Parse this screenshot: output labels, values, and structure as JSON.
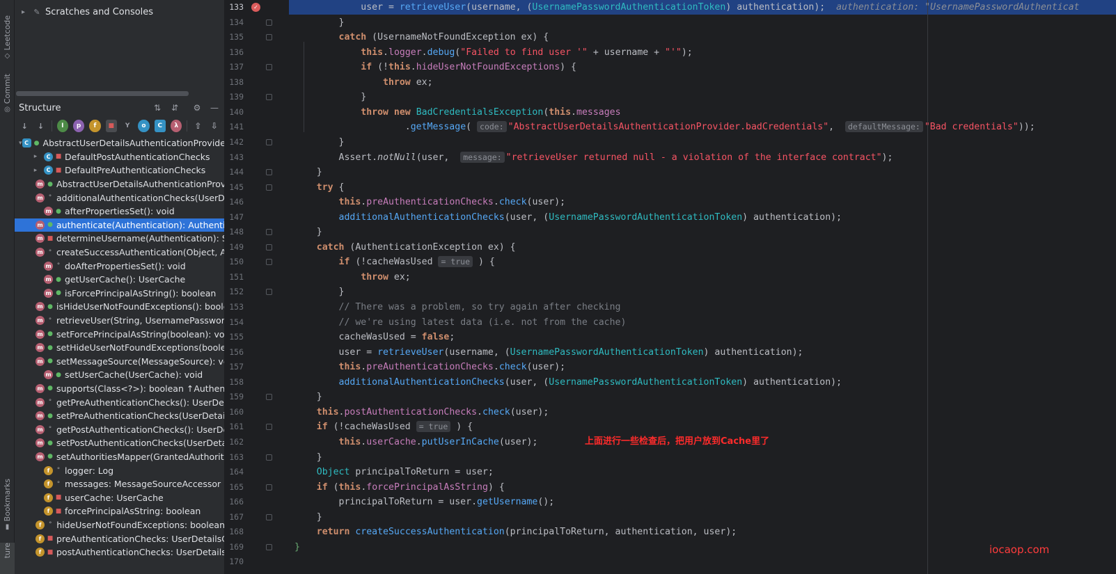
{
  "tool_strip": {
    "leetcode_label": "Leetcode",
    "commit_label": "Commit",
    "bookmarks_label": "Bookmarks",
    "structure_label": "ture"
  },
  "project": {
    "rows": [
      {
        "label": "Scratches and Consoles",
        "icon": "scratches-icon"
      }
    ]
  },
  "structure": {
    "title": "Structure",
    "tree": [
      {
        "label": "AbstractUserDetailsAuthenticationProvider",
        "kind": "class",
        "indent": 0,
        "expanded": true,
        "vis": "pub"
      },
      {
        "label": "DefaultPostAuthenticationChecks",
        "kind": "c",
        "indent": 1,
        "expandable": true,
        "vis": "lock"
      },
      {
        "label": "DefaultPreAuthenticationChecks",
        "kind": "c",
        "indent": 1,
        "expandable": true,
        "vis": "lock"
      },
      {
        "label": "AbstractUserDetailsAuthenticationProvic",
        "kind": "m",
        "indent": 1,
        "vis": "pub"
      },
      {
        "label": "additionalAuthenticationChecks(UserDet",
        "kind": "m",
        "indent": 1,
        "vis": "pkg"
      },
      {
        "label": "afterPropertiesSet(): void",
        "kind": "m",
        "indent": 1,
        "vis": "pub"
      },
      {
        "label": "authenticate(Authentication): Authenticat",
        "kind": "m",
        "indent": 1,
        "vis": "pub",
        "selected": true
      },
      {
        "label": "determineUsername(Authentication): Str",
        "kind": "m",
        "indent": 1,
        "vis": "lock"
      },
      {
        "label": "createSuccessAuthentication(Object, Aut",
        "kind": "m",
        "indent": 1,
        "vis": "pkg"
      },
      {
        "label": "doAfterPropertiesSet(): void",
        "kind": "m",
        "indent": 1,
        "vis": "pkg"
      },
      {
        "label": "getUserCache(): UserCache",
        "kind": "m",
        "indent": 1,
        "vis": "pub"
      },
      {
        "label": "isForcePrincipalAsString(): boolean",
        "kind": "m",
        "indent": 1,
        "vis": "pub"
      },
      {
        "label": "isHideUserNotFoundExceptions(): boole",
        "kind": "m",
        "indent": 1,
        "vis": "pub"
      },
      {
        "label": "retrieveUser(String, UsernamePassword",
        "kind": "m",
        "indent": 1,
        "vis": "pkg"
      },
      {
        "label": "setForcePrincipalAsString(boolean): voic",
        "kind": "m",
        "indent": 1,
        "vis": "pub"
      },
      {
        "label": "setHideUserNotFoundExceptions(boole",
        "kind": "m",
        "indent": 1,
        "vis": "pub"
      },
      {
        "label": "setMessageSource(MessageSource): vc",
        "kind": "m",
        "indent": 1,
        "vis": "pub"
      },
      {
        "label": "setUserCache(UserCache): void",
        "kind": "m",
        "indent": 1,
        "vis": "pub"
      },
      {
        "label": "supports(Class<?>): boolean ↑Authentic",
        "kind": "m",
        "indent": 1,
        "vis": "pub"
      },
      {
        "label": "getPreAuthenticationChecks(): UserDeta",
        "kind": "m",
        "indent": 1,
        "vis": "pkg"
      },
      {
        "label": "setPreAuthenticationChecks(UserDetails",
        "kind": "m",
        "indent": 1,
        "vis": "pub"
      },
      {
        "label": "getPostAuthenticationChecks(): UserDet",
        "kind": "m",
        "indent": 1,
        "vis": "pkg"
      },
      {
        "label": "setPostAuthenticationChecks(UserDetail",
        "kind": "m",
        "indent": 1,
        "vis": "pub"
      },
      {
        "label": "setAuthoritiesMapper(GrantedAuthoritie",
        "kind": "m",
        "indent": 1,
        "vis": "pub"
      },
      {
        "label": "logger: Log",
        "kind": "f",
        "indent": 1,
        "vis": "pkg"
      },
      {
        "label": "messages: MessageSourceAccessor",
        "kind": "f",
        "indent": 1,
        "vis": "pkg"
      },
      {
        "label": "userCache: UserCache",
        "kind": "f",
        "indent": 1,
        "vis": "lock"
      },
      {
        "label": "forcePrincipalAsString: boolean",
        "kind": "f",
        "indent": 1,
        "vis": "lock"
      },
      {
        "label": "hideUserNotFoundExceptions: boolean",
        "kind": "f",
        "indent": 1,
        "vis": "pkg"
      },
      {
        "label": "preAuthenticationChecks: UserDetailsCh",
        "kind": "f",
        "indent": 1,
        "vis": "lock"
      },
      {
        "label": "postAuthenticationChecks: UserDetailsC",
        "kind": "f",
        "indent": 1,
        "vis": "lock"
      }
    ]
  },
  "editor": {
    "annotation": "上面进行一些检查后，把用户放到Cache里了",
    "watermark": "iocaop.com",
    "line_numbers": [
      "133",
      "134",
      "135",
      "136",
      "137",
      "138",
      "139",
      "140",
      "141",
      "142",
      "143",
      "144",
      "145",
      "146",
      "147",
      "148",
      "149",
      "150",
      "151",
      "152",
      "153",
      "154",
      "155",
      "156",
      "157",
      "158",
      "159",
      "160",
      "161",
      "162",
      "163",
      "164",
      "165",
      "166",
      "167",
      "168",
      "169",
      "170"
    ],
    "current_line": "133",
    "lines": [
      [
        {
          "t": "            user = "
        },
        {
          "t": "retrieveUser",
          "c": "fn"
        },
        {
          "t": "(username, ("
        },
        {
          "t": "UsernamePasswordAuthenticationToken",
          "c": "typ"
        },
        {
          "t": ") authentication);  "
        },
        {
          "t": "authentication: \"UsernamePasswordAuthenticat",
          "c": "inl"
        }
      ],
      [
        {
          "t": "        }"
        }
      ],
      [
        {
          "t": "        "
        },
        {
          "t": "catch",
          "c": "kw"
        },
        {
          "t": " (UsernameNotFoundException ex) {"
        }
      ],
      [
        {
          "t": "            "
        },
        {
          "t": "this",
          "c": "kw"
        },
        {
          "t": "."
        },
        {
          "t": "logger",
          "c": "fld"
        },
        {
          "t": "."
        },
        {
          "t": "debug",
          "c": "fn"
        },
        {
          "t": "("
        },
        {
          "t": "\"Failed to find user '\"",
          "c": "istr"
        },
        {
          "t": " + username + "
        },
        {
          "t": "\"'\"",
          "c": "istr"
        },
        {
          "t": ");"
        }
      ],
      [
        {
          "t": "            "
        },
        {
          "t": "if",
          "c": "kw"
        },
        {
          "t": " (!"
        },
        {
          "t": "this",
          "c": "kw"
        },
        {
          "t": "."
        },
        {
          "t": "hideUserNotFoundExceptions",
          "c": "fld"
        },
        {
          "t": ") {"
        }
      ],
      [
        {
          "t": "                "
        },
        {
          "t": "throw",
          "c": "kw"
        },
        {
          "t": " ex;"
        }
      ],
      [
        {
          "t": "            }"
        }
      ],
      [
        {
          "t": "            "
        },
        {
          "t": "throw new",
          "c": "kw"
        },
        {
          "t": " "
        },
        {
          "t": "BadCredentialsException",
          "c": "typ"
        },
        {
          "t": "("
        },
        {
          "t": "this",
          "c": "kw"
        },
        {
          "t": "."
        },
        {
          "t": "messages",
          "c": "fld"
        }
      ],
      [
        {
          "t": "                    ."
        },
        {
          "t": "getMessage",
          "c": "fn"
        },
        {
          "t": "( "
        },
        {
          "t": "code:",
          "c": "hint"
        },
        {
          "t": "\"AbstractUserDetailsAuthenticationProvider.badCredentials\"",
          "c": "istr"
        },
        {
          "t": ",  "
        },
        {
          "t": "defaultMessage:",
          "c": "hint"
        },
        {
          "t": "\"Bad credentials\"",
          "c": "istr"
        },
        {
          "t": "));"
        }
      ],
      [
        {
          "t": "        }"
        }
      ],
      [
        {
          "t": "        "
        },
        {
          "t": "Assert",
          "c": "cls2"
        },
        {
          "t": "."
        },
        {
          "t": "notNull",
          "c": "ital"
        },
        {
          "t": "(user,  "
        },
        {
          "t": "message:",
          "c": "hint"
        },
        {
          "t": "\"retrieveUser returned null - a violation of the interface contract\"",
          "c": "istr"
        },
        {
          "t": ");"
        }
      ],
      [
        {
          "t": "    }"
        }
      ],
      [
        {
          "t": "    "
        },
        {
          "t": "try",
          "c": "kw"
        },
        {
          "t": " {"
        }
      ],
      [
        {
          "t": "        "
        },
        {
          "t": "this",
          "c": "kw"
        },
        {
          "t": "."
        },
        {
          "t": "preAuthenticationChecks",
          "c": "fld"
        },
        {
          "t": "."
        },
        {
          "t": "check",
          "c": "fn"
        },
        {
          "t": "(user);"
        }
      ],
      [
        {
          "t": "        "
        },
        {
          "t": "additionalAuthenticationChecks",
          "c": "fn"
        },
        {
          "t": "(user, ("
        },
        {
          "t": "UsernamePasswordAuthenticationToken",
          "c": "typ"
        },
        {
          "t": ") authentication);"
        }
      ],
      [
        {
          "t": "    }"
        }
      ],
      [
        {
          "t": "    "
        },
        {
          "t": "catch",
          "c": "kw"
        },
        {
          "t": " (AuthenticationException ex) {"
        }
      ],
      [
        {
          "t": "        "
        },
        {
          "t": "if",
          "c": "kw"
        },
        {
          "t": " (!cacheWasUsed "
        },
        {
          "t": "= true",
          "c": "itrue"
        },
        {
          "t": " ) {"
        }
      ],
      [
        {
          "t": "            "
        },
        {
          "t": "throw",
          "c": "kw"
        },
        {
          "t": " ex;"
        }
      ],
      [
        {
          "t": "        }"
        }
      ],
      [
        {
          "t": "        "
        },
        {
          "t": "// There was a problem, so try again after checking",
          "c": "cmt"
        }
      ],
      [
        {
          "t": "        "
        },
        {
          "t": "// we're using latest data (i.e. not from the cache)",
          "c": "cmt"
        }
      ],
      [
        {
          "t": "        cacheWasUsed = "
        },
        {
          "t": "false",
          "c": "kw"
        },
        {
          "t": ";"
        }
      ],
      [
        {
          "t": "        user = "
        },
        {
          "t": "retrieveUser",
          "c": "fn"
        },
        {
          "t": "(username, ("
        },
        {
          "t": "UsernamePasswordAuthenticationToken",
          "c": "typ"
        },
        {
          "t": ") authentication);"
        }
      ],
      [
        {
          "t": "        "
        },
        {
          "t": "this",
          "c": "kw"
        },
        {
          "t": "."
        },
        {
          "t": "preAuthenticationChecks",
          "c": "fld"
        },
        {
          "t": "."
        },
        {
          "t": "check",
          "c": "fn"
        },
        {
          "t": "(user);"
        }
      ],
      [
        {
          "t": "        "
        },
        {
          "t": "additionalAuthenticationChecks",
          "c": "fn"
        },
        {
          "t": "(user, ("
        },
        {
          "t": "UsernamePasswordAuthenticationToken",
          "c": "typ"
        },
        {
          "t": ") authentication);"
        }
      ],
      [
        {
          "t": "    }"
        }
      ],
      [
        {
          "t": "    "
        },
        {
          "t": "this",
          "c": "kw"
        },
        {
          "t": "."
        },
        {
          "t": "postAuthenticationChecks",
          "c": "fld"
        },
        {
          "t": "."
        },
        {
          "t": "check",
          "c": "fn"
        },
        {
          "t": "(user);"
        }
      ],
      [
        {
          "t": "    "
        },
        {
          "t": "if",
          "c": "kw"
        },
        {
          "t": " (!cacheWasUsed "
        },
        {
          "t": "= true",
          "c": "itrue"
        },
        {
          "t": " ) {"
        }
      ],
      [
        {
          "t": "        "
        },
        {
          "t": "this",
          "c": "kw"
        },
        {
          "t": "."
        },
        {
          "t": "userCache",
          "c": "fld"
        },
        {
          "t": "."
        },
        {
          "t": "putUserInCache",
          "c": "fn"
        },
        {
          "t": "(user);"
        }
      ],
      [
        {
          "t": "    }"
        }
      ],
      [
        {
          "t": "    "
        },
        {
          "t": "Object",
          "c": "typ"
        },
        {
          "t": " principalToReturn = user;"
        }
      ],
      [
        {
          "t": "    "
        },
        {
          "t": "if",
          "c": "kw"
        },
        {
          "t": " ("
        },
        {
          "t": "this",
          "c": "kw"
        },
        {
          "t": "."
        },
        {
          "t": "forcePrincipalAsString",
          "c": "fld"
        },
        {
          "t": ") {"
        }
      ],
      [
        {
          "t": "        principalToReturn = user."
        },
        {
          "t": "getUsername",
          "c": "fn"
        },
        {
          "t": "();"
        }
      ],
      [
        {
          "t": "    }"
        }
      ],
      [
        {
          "t": "    "
        },
        {
          "t": "return",
          "c": "kw"
        },
        {
          "t": " "
        },
        {
          "t": "createSuccessAuthentication",
          "c": "fn"
        },
        {
          "t": "(principalToReturn, authentication, user);"
        }
      ],
      [
        {
          "t": "}",
          "c": "str"
        }
      ],
      [
        {
          "t": ""
        }
      ]
    ]
  }
}
